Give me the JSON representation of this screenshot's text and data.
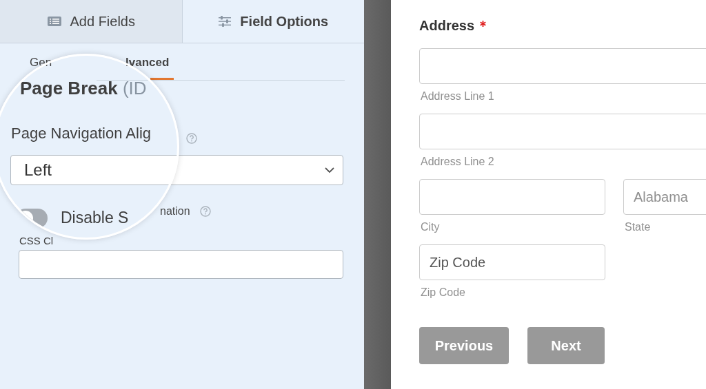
{
  "panel_tabs": [
    {
      "label": "Add Fields",
      "selected": false,
      "kind": "list"
    },
    {
      "label": "Field Options",
      "selected": true,
      "kind": "sliders"
    }
  ],
  "sub_tabs": [
    {
      "label": "Gen",
      "selected": false
    },
    {
      "label": "lvanced",
      "selected": true
    }
  ],
  "field_title": {
    "name": "Page Break",
    "id_label": "(ID"
  },
  "nav_alignment": {
    "label": "Page Navigation Alig",
    "value": "Left"
  },
  "scroll_animation": {
    "label_fragment": "nation",
    "toggle_label": "Disable S",
    "on": false
  },
  "css_class": {
    "label": "CSS Cl"
  },
  "form": {
    "field_label": "Address",
    "required": true,
    "address_line_1": {
      "sublabel": "Address Line 1"
    },
    "address_line_2": {
      "sublabel": "Address Line 2"
    },
    "city": {
      "sublabel": "City"
    },
    "state": {
      "value": "Alabama",
      "sublabel": "State"
    },
    "zip": {
      "placeholder": "Zip Code",
      "sublabel": "Zip Code"
    },
    "buttons": [
      "Previous",
      "Next"
    ]
  }
}
